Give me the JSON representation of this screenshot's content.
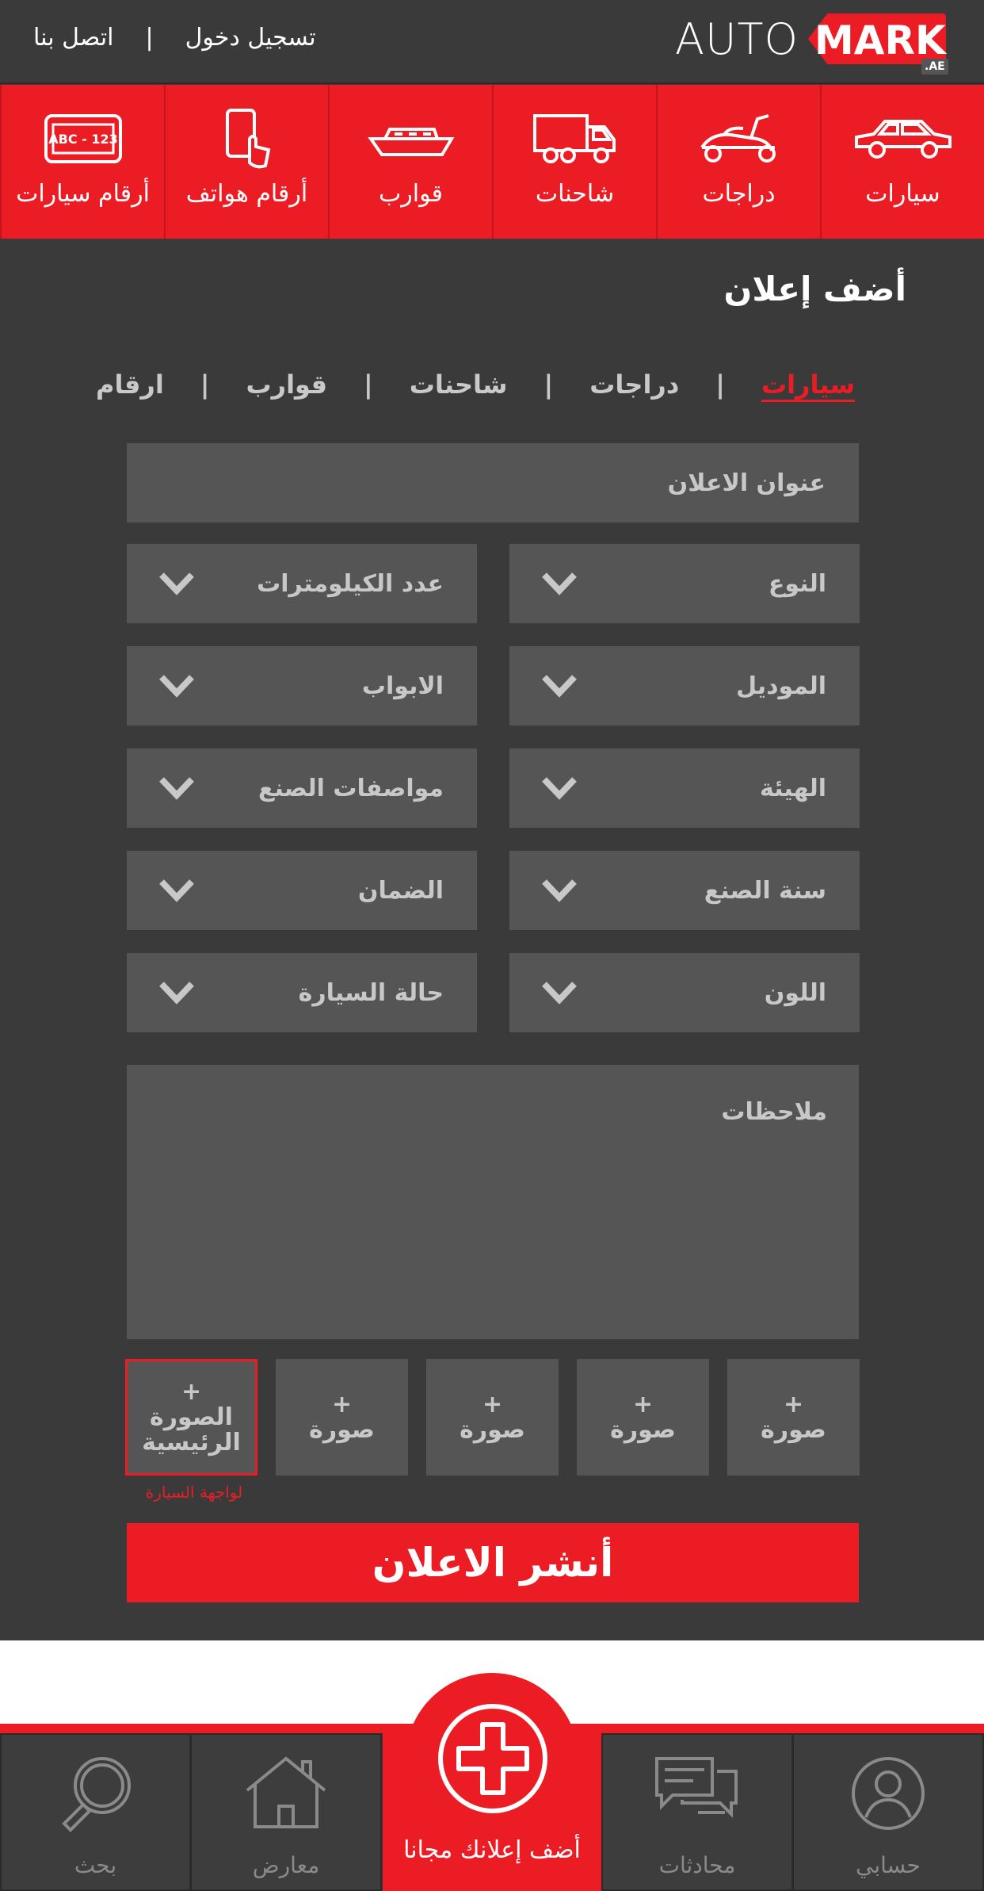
{
  "brand": {
    "auto": "AUTO",
    "mark": "MARK",
    "tld": ".AE"
  },
  "top_links": {
    "login": "تسجيل دخول",
    "separator": "|",
    "contact": "اتصل بنا"
  },
  "categories": [
    {
      "label": "سيارات",
      "icon": "car-icon"
    },
    {
      "label": "دراجات",
      "icon": "scooter-icon"
    },
    {
      "label": "شاحنات",
      "icon": "truck-icon"
    },
    {
      "label": "قوارب",
      "icon": "boat-icon"
    },
    {
      "label": "أرقام هواتف",
      "icon": "phone-icon"
    },
    {
      "label": "أرقام سيارات",
      "icon": "license-plate-icon",
      "plate_text": "ABC - 123"
    }
  ],
  "form": {
    "title": "أضف إعلان",
    "tabs": [
      "سيارات",
      "دراجات",
      "شاحنات",
      "قوارب",
      "ارقام"
    ],
    "active_tab": "سيارات",
    "tab_separator": "|",
    "ad_title_placeholder": "عنوان الاعلان",
    "fields_right": [
      "النوع",
      "الموديل",
      "الهيئة",
      "سنة الصنع",
      "اللون"
    ],
    "fields_left": [
      "عدد الكيلومترات",
      "الابواب",
      "مواصفات الصنع",
      "الضمان",
      "حالة السيارة"
    ],
    "notes_placeholder": "ملاحظات",
    "photo_plus": "+",
    "photo_label": "صورة",
    "main_photo_label": "الصورة الرئيسية",
    "main_photo_note": "لواجهة السيارة",
    "publish_label": "أنشر الاعلان"
  },
  "bottom_nav": {
    "account": "حسابي",
    "chats": "محادثات",
    "add": "أضف إعلانك مجانا",
    "showrooms": "معارض",
    "search": "بحث"
  },
  "colors": {
    "accent": "#ec1c24",
    "background": "#3a3a3a",
    "field": "#555555"
  }
}
